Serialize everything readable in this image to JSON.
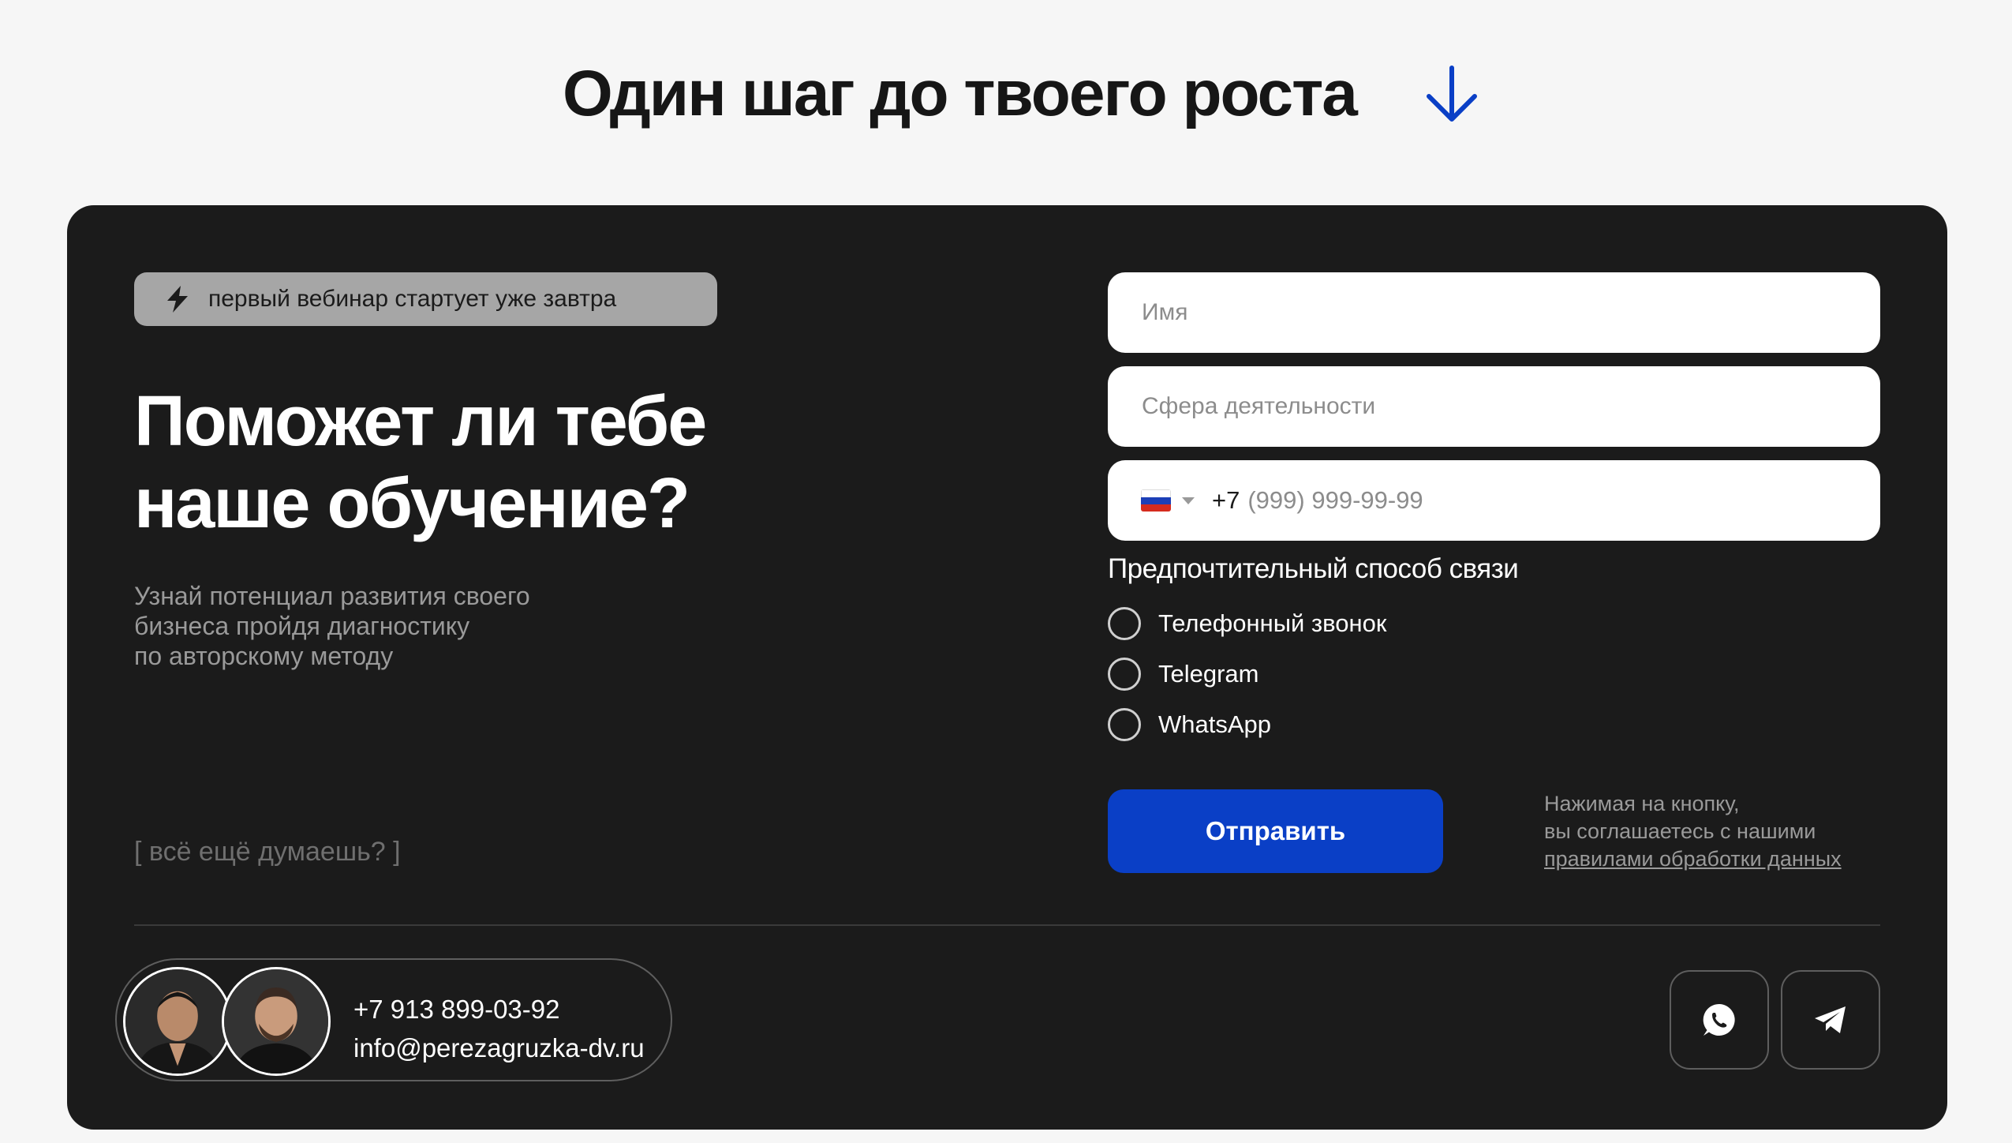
{
  "header": {
    "title": "Один шаг до твоего роста",
    "arrow_icon": "arrow-down-icon",
    "accent_color": "#0a3fc6"
  },
  "promo": {
    "badge_text": "первый вебинар стартует уже завтра",
    "badge_icon": "lightning-icon",
    "headline": "Поможет ли тебе наше обучение?",
    "subtext": "Узнай потенциал развития своего\nбизнеса пройдя диагностику\nпо авторскому методу",
    "thinking_text": "[ всё ещё думаешь? ]"
  },
  "form": {
    "name_placeholder": "Имя",
    "field_placeholder": "Сфера деятельности",
    "phone": {
      "country_flag": "russia-flag-icon",
      "code": "+7",
      "mask": "(999) 999-99-99"
    },
    "contact_method_title": "Предпочтительный способ связи",
    "contact_options": [
      {
        "label": "Телефонный звонок",
        "selected": false
      },
      {
        "label": "Telegram",
        "selected": false
      },
      {
        "label": "WhatsApp",
        "selected": false
      }
    ],
    "submit_label": "Отправить",
    "consent_line1": "Нажимая на кнопку,",
    "consent_line2": "вы соглашаетесь с нашими",
    "consent_link": "правилами обработки данных"
  },
  "footer": {
    "phone": "+7 913 899-03-92",
    "email": "info@perezagruzka-dv.ru",
    "social": [
      "whatsapp-icon",
      "telegram-icon"
    ]
  }
}
